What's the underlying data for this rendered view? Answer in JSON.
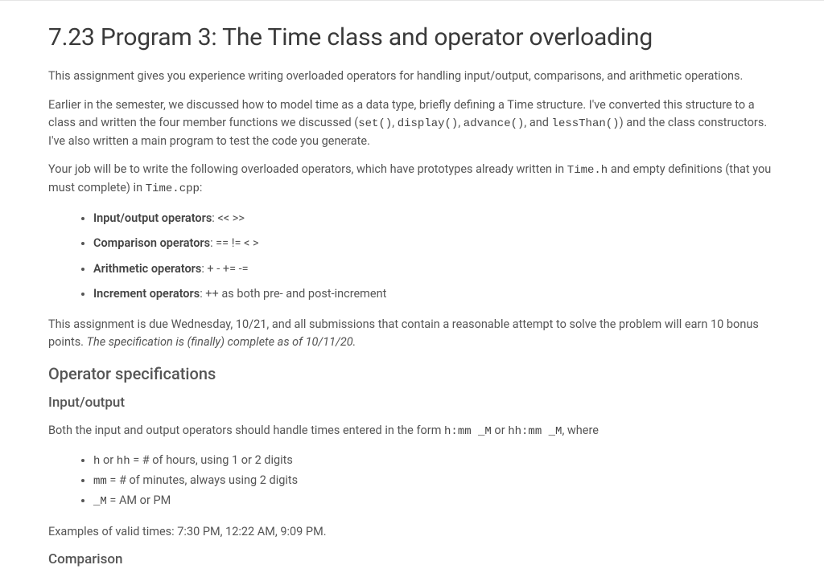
{
  "title": "7.23 Program 3: The Time class and operator overloading",
  "intro1": "This assignment gives you experience writing overloaded operators for handling input/output, comparisons, and arithmetic operations.",
  "intro2_a": "Earlier in the semester, we discussed how to model time as a data type, briefly defining a Time structure. I've converted this structure to a class and written the four member functions we discussed (",
  "fn_set": "set()",
  "sep1": ", ",
  "fn_display": "display()",
  "sep2": ", ",
  "fn_advance": "advance()",
  "sep3": ", and ",
  "fn_lessThan": "lessThan()",
  "intro2_b": ") and the class constructors. I've also written a main program to test the code you generate.",
  "intro3_a": "Your job will be to write the following overloaded operators, which have prototypes already written in ",
  "file_h": "Time.h",
  "intro3_b": " and empty definitions (that you must complete) in ",
  "file_cpp": "Time.cpp",
  "intro3_c": ":",
  "ops": {
    "io_label": "Input/output operators",
    "io_val": ": << >>",
    "cmp_label": "Comparison operators",
    "cmp_val": ": ==  !=  <  >",
    "arith_label": "Arithmetic operators",
    "arith_val": ": +  -  +=  -=",
    "inc_label": "Increment operators",
    "inc_val": ": ++ as both pre- and post-increment"
  },
  "due_a": "This assignment is due Wednesday, 10/21, and all submissions that contain a reasonable attempt to solve the problem will earn 10 bonus points. ",
  "due_italic": "The specification is (finally) complete as of 10/11/20.",
  "h2_spec": "Operator specifications",
  "h3_io": "Input/output",
  "io_para_a": "Both the input and output operators should handle times entered in the form ",
  "fmt1": "h:mm _M",
  "io_para_b": " or ",
  "fmt2": "hh:mm _M",
  "io_para_c": ", where",
  "fmtlist": {
    "l1a": "h",
    "l1b": " or ",
    "l1c": "hh",
    "l1d": " = # of hours, using 1 or 2 digits",
    "l2a": "mm",
    "l2b": " = # of minutes, always using 2 digits",
    "l3a": "_M",
    "l3b": " = AM or PM"
  },
  "examples": "Examples of valid times: 7:30 PM, 12:22 AM, 9:09 PM.",
  "h3_cmp": "Comparison"
}
